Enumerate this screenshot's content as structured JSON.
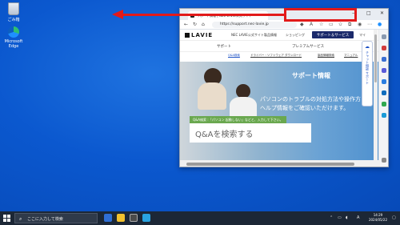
{
  "desktop": {
    "icons": [
      {
        "label": "ごみ箱"
      },
      {
        "label": "Microsoft Edge"
      }
    ]
  },
  "browser": {
    "tab_title": "サポート情報 | NEC LAVIE公式サイト",
    "url": "https://support.nec-lavie.jp",
    "site": {
      "logo": "LAVIE",
      "header_links": [
        "NEC LAVIE公式サイト",
        "製品情報",
        "ショッピング"
      ],
      "header_button": "サポート＆サービス",
      "header_more": "マイ",
      "subnav": [
        "サポート",
        "プレミアムサービス"
      ],
      "subnav2": [
        "Q&A検索",
        "ドライバー・ソフトウェア ダウンロード",
        "製品情報検索",
        "マニュアル"
      ],
      "hero_title": "サポート情報",
      "hero_line1": "パソコンのトラブルの対処方法や操作方",
      "hero_line2": "ヘルプ情報をご確認いただけます。",
      "qa_hint": "Q&A検索 :「パソコン 起動しない」などと、入力して下さい。",
      "qa_placeholder": "Q&Aを検索する",
      "side_panel": "チャット相談 サポート"
    }
  },
  "taskbar": {
    "search_placeholder": "ここに入力して検索",
    "time": "14:29",
    "date": "2024/05/22",
    "ime": "A"
  }
}
